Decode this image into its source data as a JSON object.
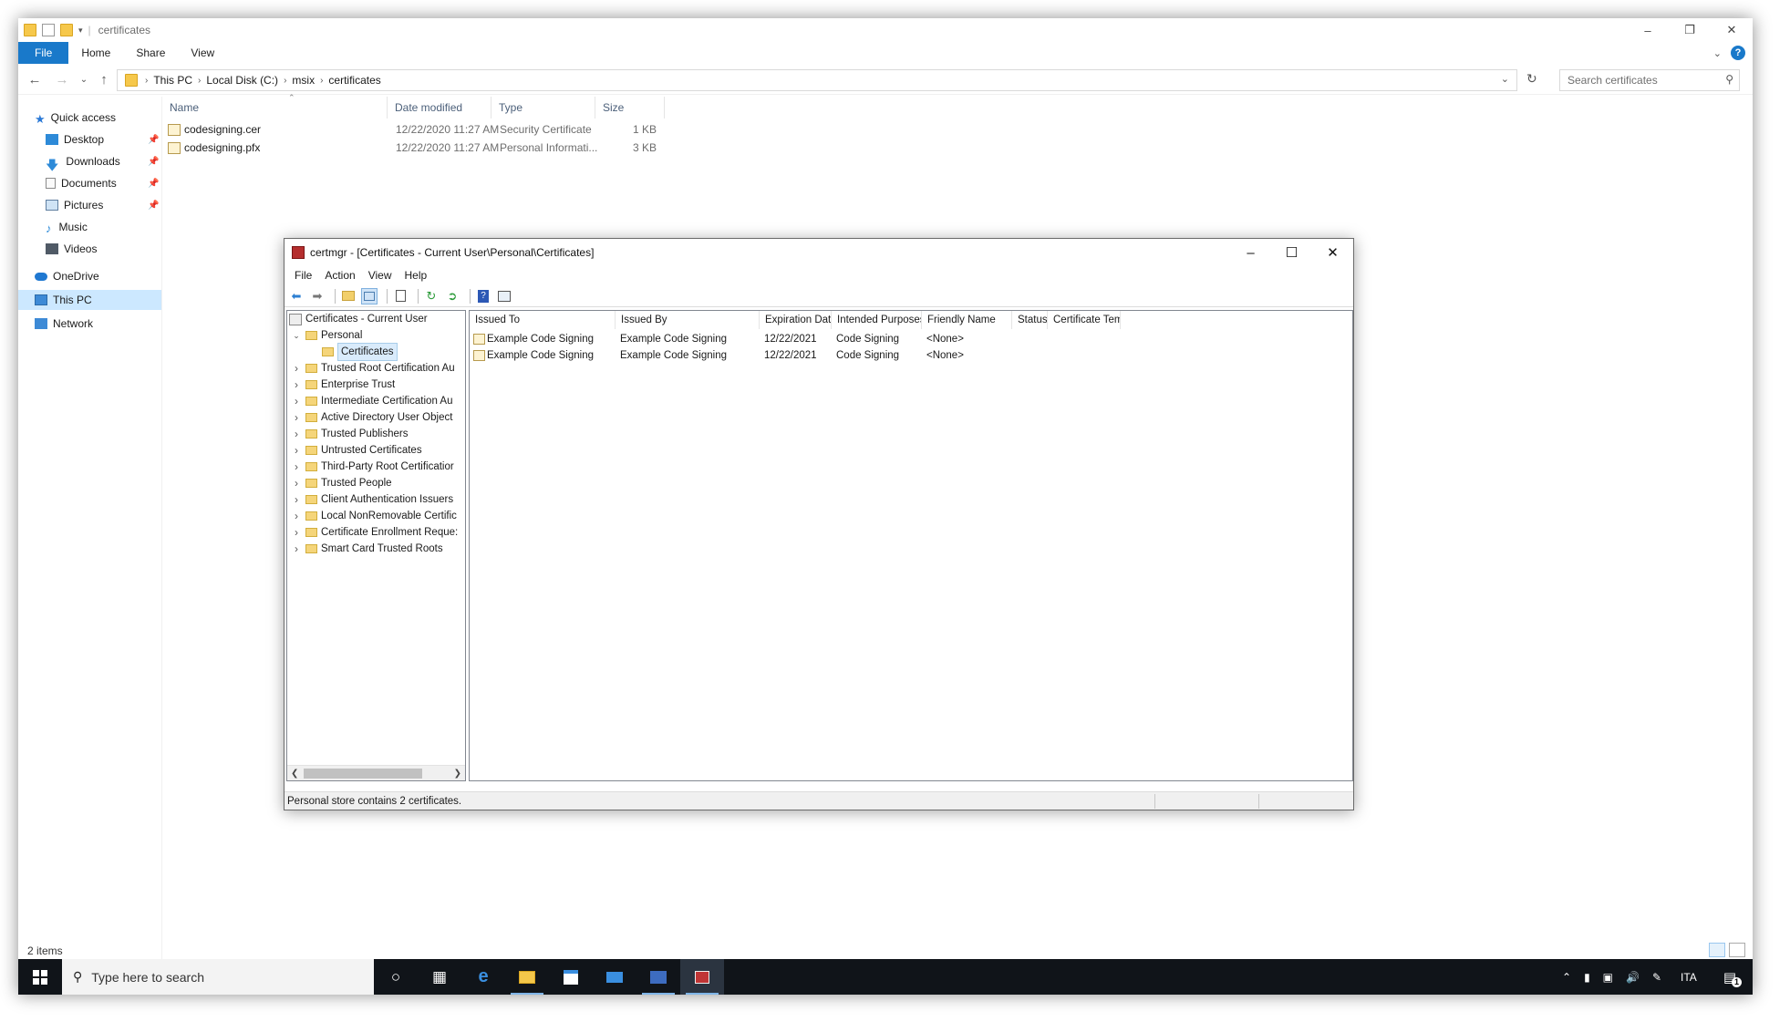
{
  "explorer": {
    "title": "certificates",
    "ribbon_tabs": [
      "File",
      "Home",
      "Share",
      "View"
    ],
    "breadcrumb": [
      "This PC",
      "Local Disk (C:)",
      "msix",
      "certificates"
    ],
    "search_placeholder": "Search certificates",
    "nav": {
      "quick_access": "Quick access",
      "items": [
        "Desktop",
        "Downloads",
        "Documents",
        "Pictures",
        "Music",
        "Videos"
      ],
      "onedrive": "OneDrive",
      "this_pc": "This PC",
      "network": "Network"
    },
    "columns": [
      "Name",
      "Date modified",
      "Type",
      "Size"
    ],
    "files": [
      {
        "name": "codesigning.cer",
        "date": "12/22/2020 11:27 AM",
        "type": "Security Certificate",
        "size": "1 KB"
      },
      {
        "name": "codesigning.pfx",
        "date": "12/22/2020 11:27 AM",
        "type": "Personal Informati...",
        "size": "3 KB"
      }
    ],
    "status": "2 items"
  },
  "certmgr": {
    "title": "certmgr - [Certificates - Current User\\Personal\\Certificates]",
    "menu": [
      "File",
      "Action",
      "View",
      "Help"
    ],
    "tree": {
      "root": "Certificates - Current User",
      "personal": "Personal",
      "certificates": "Certificates",
      "stores": [
        "Trusted Root Certification Au",
        "Enterprise Trust",
        "Intermediate Certification Au",
        "Active Directory User Object",
        "Trusted Publishers",
        "Untrusted Certificates",
        "Third-Party Root Certificatior",
        "Trusted People",
        "Client Authentication Issuers",
        "Local NonRemovable Certific",
        "Certificate Enrollment Reque:",
        "Smart Card Trusted Roots"
      ]
    },
    "columns": [
      "Issued To",
      "Issued By",
      "Expiration Date",
      "Intended Purposes",
      "Friendly Name",
      "Status",
      "Certificate Tem..."
    ],
    "rows": [
      {
        "issued_to": "Example Code Signing",
        "issued_by": "Example Code Signing",
        "expiration": "12/22/2021",
        "purposes": "Code Signing",
        "friendly": "<None>"
      },
      {
        "issued_to": "Example Code Signing",
        "issued_by": "Example Code Signing",
        "expiration": "12/22/2021",
        "purposes": "Code Signing",
        "friendly": "<None>"
      }
    ],
    "status": "Personal store contains 2 certificates."
  },
  "taskbar": {
    "search_placeholder": "Type here to search",
    "language": "ITA",
    "notification_count": "1"
  }
}
